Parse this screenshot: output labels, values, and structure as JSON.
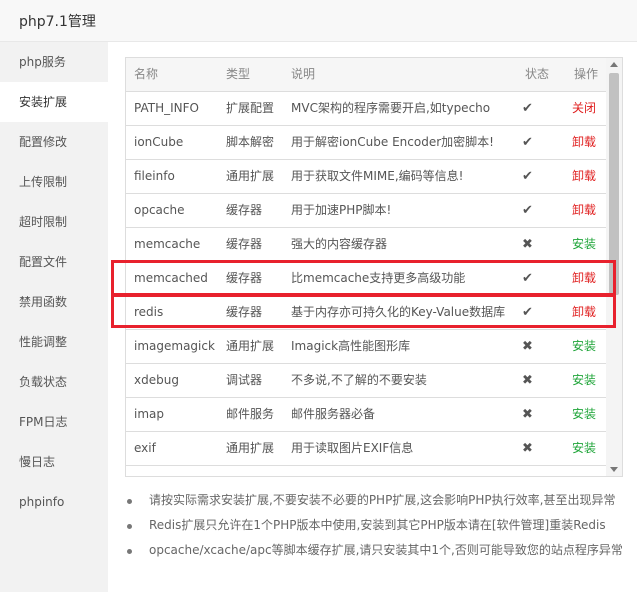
{
  "window": {
    "title": "php7.1管理"
  },
  "sidebar": {
    "items": [
      {
        "label": "php服务",
        "active": false
      },
      {
        "label": "安装扩展",
        "active": true
      },
      {
        "label": "配置修改",
        "active": false
      },
      {
        "label": "上传限制",
        "active": false
      },
      {
        "label": "超时限制",
        "active": false
      },
      {
        "label": "配置文件",
        "active": false
      },
      {
        "label": "禁用函数",
        "active": false
      },
      {
        "label": "性能调整",
        "active": false
      },
      {
        "label": "负载状态",
        "active": false
      },
      {
        "label": "FPM日志",
        "active": false
      },
      {
        "label": "慢日志",
        "active": false
      },
      {
        "label": "phpinfo",
        "active": false
      }
    ]
  },
  "table": {
    "headers": {
      "name": "名称",
      "type": "类型",
      "desc": "说明",
      "status": "状态",
      "op": "操作"
    },
    "rows": [
      {
        "name": "PATH_INFO",
        "type": "扩展配置",
        "desc": "MVC架构的程序需要开启,如typecho",
        "status": "✔",
        "status_icon": "check-icon",
        "op": "关闭",
        "op_color": "red"
      },
      {
        "name": "ionCube",
        "type": "脚本解密",
        "desc": "用于解密ionCube Encoder加密脚本!",
        "status": "✔",
        "status_icon": "check-icon",
        "op": "卸载",
        "op_color": "red"
      },
      {
        "name": "fileinfo",
        "type": "通用扩展",
        "desc": "用于获取文件MIME,编码等信息!",
        "status": "✔",
        "status_icon": "check-icon",
        "op": "卸载",
        "op_color": "red"
      },
      {
        "name": "opcache",
        "type": "缓存器",
        "desc": "用于加速PHP脚本!",
        "status": "✔",
        "status_icon": "check-icon",
        "op": "卸载",
        "op_color": "red"
      },
      {
        "name": "memcache",
        "type": "缓存器",
        "desc": "强大的内容缓存器",
        "status": "✖",
        "status_icon": "cross-icon",
        "op": "安装",
        "op_color": "green"
      },
      {
        "name": "memcached",
        "type": "缓存器",
        "desc": "比memcache支持更多高级功能",
        "status": "✔",
        "status_icon": "check-icon",
        "op": "卸载",
        "op_color": "red"
      },
      {
        "name": "redis",
        "type": "缓存器",
        "desc": "基于内存亦可持久化的Key-Value数据库",
        "status": "✔",
        "status_icon": "check-icon",
        "op": "卸载",
        "op_color": "red"
      },
      {
        "name": "imagemagick",
        "type": "通用扩展",
        "desc": "Imagick高性能图形库",
        "status": "✖",
        "status_icon": "cross-icon",
        "op": "安装",
        "op_color": "green"
      },
      {
        "name": "xdebug",
        "type": "调试器",
        "desc": "不多说,不了解的不要安装",
        "status": "✖",
        "status_icon": "cross-icon",
        "op": "安装",
        "op_color": "green"
      },
      {
        "name": "imap",
        "type": "邮件服务",
        "desc": "邮件服务器必备",
        "status": "✖",
        "status_icon": "cross-icon",
        "op": "安装",
        "op_color": "green"
      },
      {
        "name": "exif",
        "type": "通用扩展",
        "desc": "用于读取图片EXIF信息",
        "status": "✖",
        "status_icon": "cross-icon",
        "op": "安装",
        "op_color": "green"
      }
    ]
  },
  "notes": [
    "请按实际需求安装扩展,不要安装不必要的PHP扩展,这会影响PHP执行效率,甚至出现异常",
    "Redis扩展只允许在1个PHP版本中使用,安装到其它PHP版本请在[软件管理]重装Redis",
    "opcache/xcache/apc等脚本缓存扩展,请只安装其中1个,否则可能导致您的站点程序异常"
  ],
  "colors": {
    "uninstall": "#e02020",
    "install": "#20a53a",
    "highlight": "#e8212d"
  }
}
